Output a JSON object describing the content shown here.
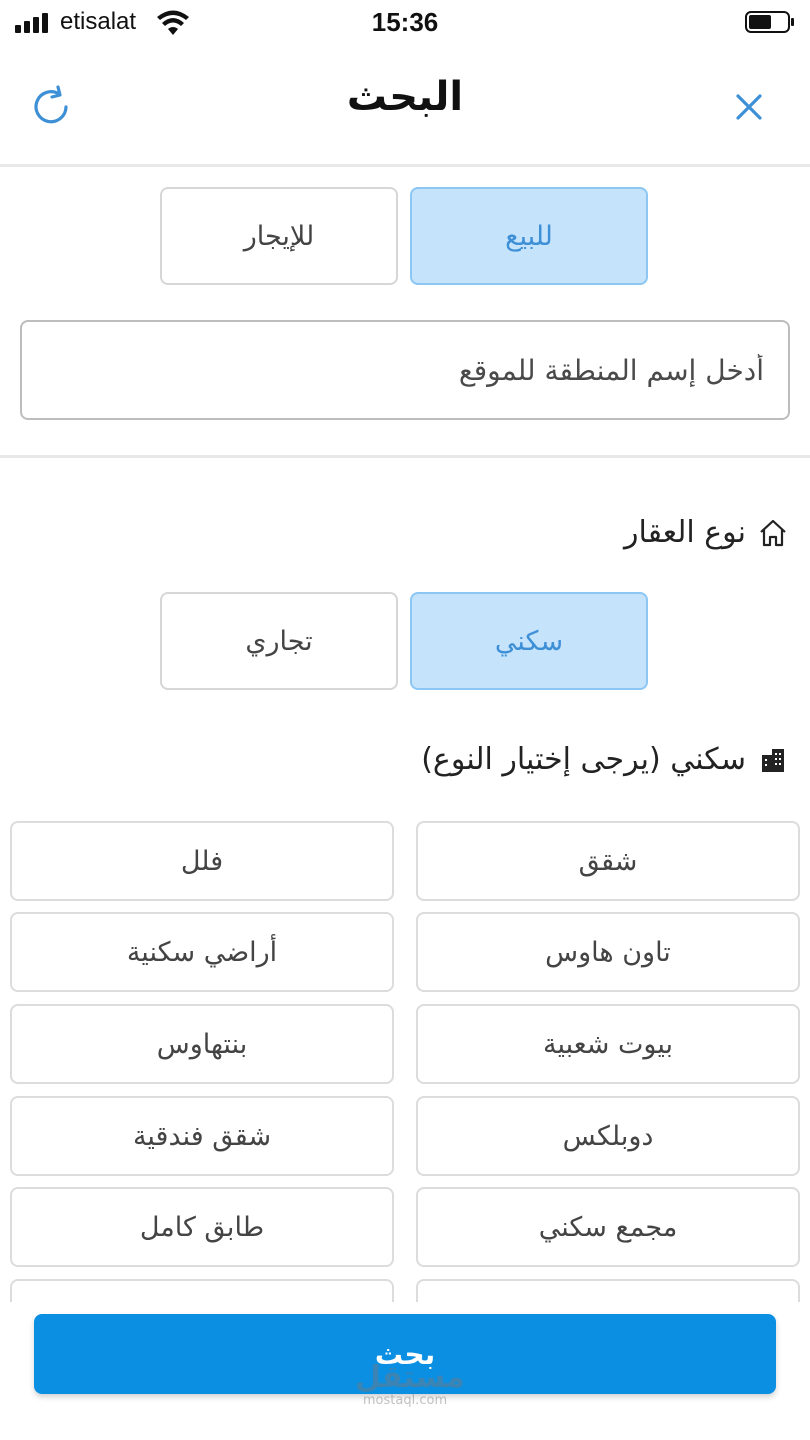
{
  "status_bar": {
    "carrier": "etisalat",
    "time": "15:36",
    "battery_level": 0.6
  },
  "header": {
    "title": "البحث",
    "refresh_icon": "refresh-icon",
    "close_icon": "close-icon"
  },
  "listing_type": {
    "options": [
      {
        "label": "للبيع",
        "selected": true
      },
      {
        "label": "للإيجار",
        "selected": false
      }
    ]
  },
  "location": {
    "placeholder": "أدخل إسم المنطقة للموقع",
    "value": ""
  },
  "property_type": {
    "title": "نوع العقار",
    "icon": "home-icon",
    "options": [
      {
        "label": "سكني",
        "selected": true
      },
      {
        "label": "تجاري",
        "selected": false
      }
    ]
  },
  "residential": {
    "title": "سكني (يرجى إختيار النوع)",
    "icon": "buildings-icon",
    "types": [
      {
        "label": "شقق"
      },
      {
        "label": "فلل"
      },
      {
        "label": "تاون هاوس"
      },
      {
        "label": "أراضي سكنية"
      },
      {
        "label": "بيوت شعبية"
      },
      {
        "label": "بنتهاوس"
      },
      {
        "label": "دوبلكس"
      },
      {
        "label": "شقق فندقية"
      },
      {
        "label": "مجمع سكني"
      },
      {
        "label": "طابق كامل"
      }
    ]
  },
  "search_button": {
    "label": "بحث"
  },
  "watermark": {
    "logo": "مستقل",
    "url": "mostaql.com"
  },
  "colors": {
    "accent": "#0a8fe3",
    "selected_bg": "#c5e3fb",
    "selected_text": "#3d8fd6",
    "icon_blue": "#3d8fd6"
  }
}
